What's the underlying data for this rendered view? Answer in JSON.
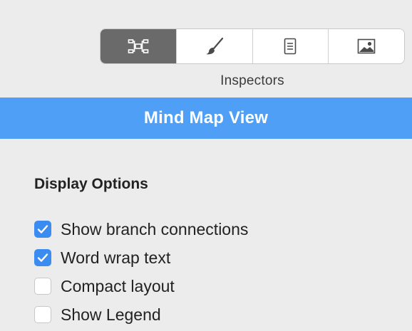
{
  "toolbar": {
    "segments": [
      {
        "icon": "mind-map-layout-icon",
        "selected": true
      },
      {
        "icon": "paintbrush-icon",
        "selected": false
      },
      {
        "icon": "document-icon",
        "selected": false
      },
      {
        "icon": "image-icon",
        "selected": false
      }
    ],
    "caption": "Inspectors"
  },
  "panel": {
    "title": "Mind Map View"
  },
  "display_options": {
    "heading": "Display Options",
    "items": [
      {
        "label": "Show branch connections",
        "checked": true
      },
      {
        "label": "Word wrap text",
        "checked": true
      },
      {
        "label": "Compact layout",
        "checked": false
      },
      {
        "label": "Show Legend",
        "checked": false
      }
    ]
  },
  "colors": {
    "accent": "#4e9ff5",
    "checkbox_checked": "#3b8cf0",
    "segment_active": "#6a6a6a",
    "background": "#ececec"
  }
}
